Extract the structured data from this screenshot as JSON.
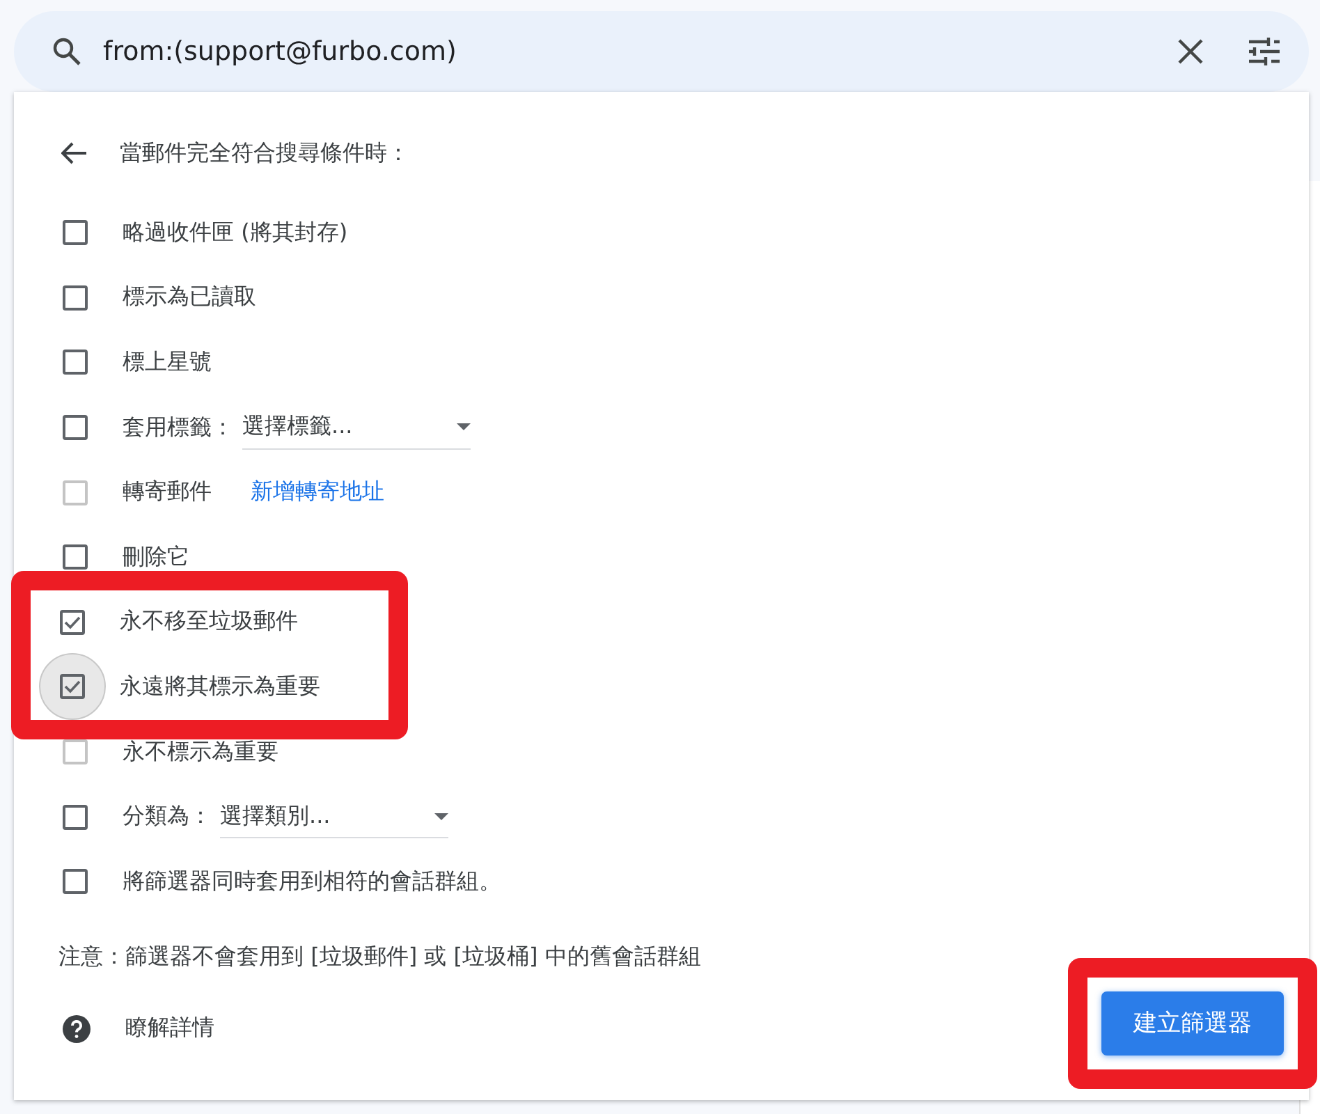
{
  "search": {
    "value": "from:(support@furbo.com)"
  },
  "dialog": {
    "heading": "當郵件完全符合搜尋條件時：",
    "options": [
      {
        "kind": "plain",
        "label": "略過收件匣 (將其封存)",
        "checked": false,
        "disabled": false,
        "focused": false,
        "highlighted": false
      },
      {
        "kind": "plain",
        "label": "標示為已讀取",
        "checked": false,
        "disabled": false,
        "focused": false,
        "highlighted": false
      },
      {
        "kind": "plain",
        "label": "標上星號",
        "checked": false,
        "disabled": false,
        "focused": false,
        "highlighted": false
      },
      {
        "kind": "dropdown",
        "label": "套用標籤：",
        "placeholder": "選擇標籤...",
        "checked": false,
        "disabled": false,
        "focused": false,
        "highlighted": false
      },
      {
        "kind": "link",
        "label": "轉寄郵件",
        "link": "新增轉寄地址",
        "checked": false,
        "disabled": true,
        "focused": false,
        "highlighted": false
      },
      {
        "kind": "plain",
        "label": "刪除它",
        "checked": false,
        "disabled": false,
        "focused": false,
        "highlighted": false
      },
      {
        "kind": "plain",
        "label": "永不移至垃圾郵件",
        "checked": true,
        "disabled": false,
        "focused": false,
        "highlighted": true
      },
      {
        "kind": "plain",
        "label": "永遠將其標示為重要",
        "checked": true,
        "disabled": false,
        "focused": true,
        "highlighted": true
      },
      {
        "kind": "plain",
        "label": "永不標示為重要",
        "checked": false,
        "disabled": true,
        "focused": false,
        "highlighted": false
      },
      {
        "kind": "dropdown",
        "label": "分類為：",
        "placeholder": "選擇類別...",
        "checked": false,
        "disabled": false,
        "focused": false,
        "highlighted": false
      },
      {
        "kind": "plain",
        "label": "將篩選器同時套用到相符的會話群組。",
        "checked": false,
        "disabled": false,
        "focused": false,
        "highlighted": false
      }
    ],
    "note": "注意：篩選器不會套用到 [垃圾郵件] 或 [垃圾桶] 中的舊會話群組",
    "learn_more": "瞭解詳情",
    "create_button": {
      "label": "建立篩選器",
      "highlighted": true
    }
  }
}
